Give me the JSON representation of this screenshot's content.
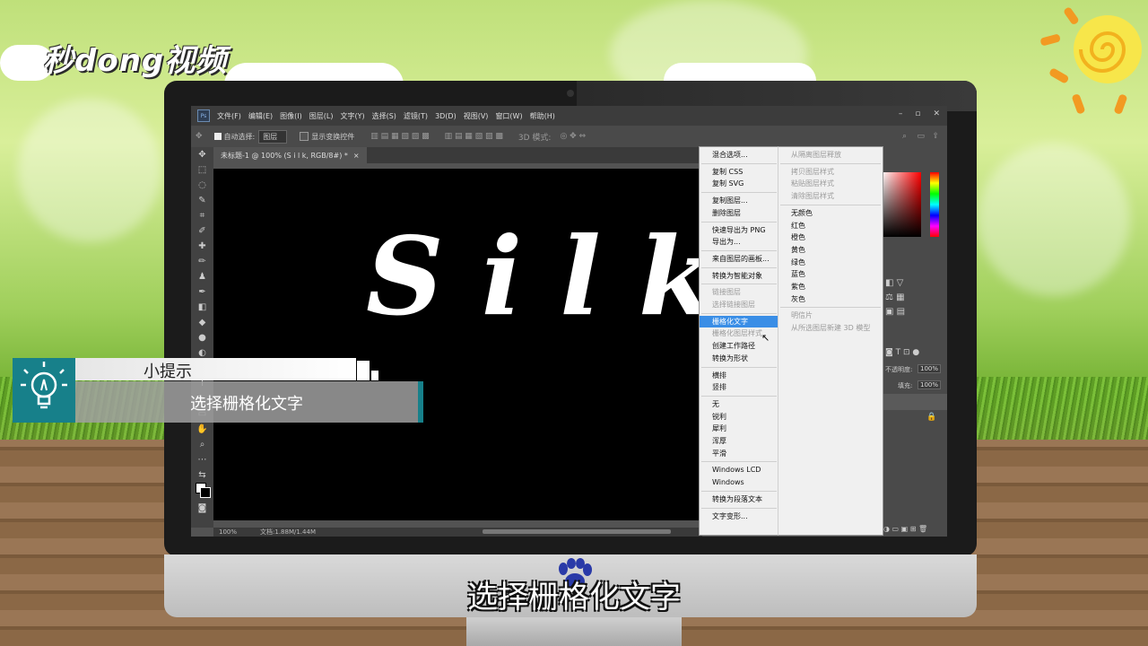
{
  "watermark": {
    "logo_text": "秒dong视频"
  },
  "photoshop": {
    "app_icon": "Ps",
    "menus": [
      "文件(F)",
      "编辑(E)",
      "图像(I)",
      "图层(L)",
      "文字(Y)",
      "选择(S)",
      "滤镜(T)",
      "3D(D)",
      "视图(V)",
      "窗口(W)",
      "帮助(H)"
    ],
    "window_buttons": [
      "–",
      "▫",
      "✕"
    ],
    "options": {
      "auto_select_label": "自动选择:",
      "auto_select_value": "图层",
      "show_transform_label": "显示变换控件",
      "mode_3d_label": "3D 模式:"
    },
    "document_tab": "未标题-1 @ 100% (S i l k, RGB/8#) *",
    "canvas_text": "Silk",
    "status": {
      "zoom": "100%",
      "doc_info": "文档:1.88M/1.44M"
    },
    "panels": {
      "opacity_label": "不透明度:",
      "opacity_value": "100%",
      "fill_label": "填充:",
      "fill_value": "100%"
    },
    "context_menu": [
      {
        "label": "混合选项...",
        "state": "normal"
      },
      {
        "sep": true
      },
      {
        "label": "复制 CSS",
        "state": "normal"
      },
      {
        "label": "复制 SVG",
        "state": "normal"
      },
      {
        "sep": true
      },
      {
        "label": "复制图层...",
        "state": "normal"
      },
      {
        "label": "删除图层",
        "state": "normal"
      },
      {
        "sep": true
      },
      {
        "label": "快速导出为 PNG",
        "state": "normal"
      },
      {
        "label": "导出为...",
        "state": "normal"
      },
      {
        "sep": true
      },
      {
        "label": "来自图层的画板...",
        "state": "normal"
      },
      {
        "sep": true
      },
      {
        "label": "转换为智能对象",
        "state": "normal"
      },
      {
        "sep": true
      },
      {
        "label": "链接图层",
        "state": "disabled"
      },
      {
        "label": "选择链接图层",
        "state": "disabled"
      },
      {
        "sep": true
      },
      {
        "label": "栅格化文字",
        "state": "highlighted"
      },
      {
        "label": "栅格化图层样式",
        "state": "disabled"
      },
      {
        "label": "创建工作路径",
        "state": "normal"
      },
      {
        "label": "转换为形状",
        "state": "normal"
      },
      {
        "sep": true
      },
      {
        "label": "横排",
        "state": "normal"
      },
      {
        "label": "竖排",
        "state": "normal"
      },
      {
        "sep": true
      },
      {
        "label": "无",
        "state": "normal"
      },
      {
        "label": "锐利",
        "state": "normal"
      },
      {
        "label": "犀利",
        "state": "normal"
      },
      {
        "label": "浑厚",
        "state": "normal"
      },
      {
        "label": "平滑",
        "state": "normal"
      },
      {
        "sep": true
      },
      {
        "label": "Windows LCD",
        "state": "normal"
      },
      {
        "label": "Windows",
        "state": "normal"
      },
      {
        "sep": true
      },
      {
        "label": "转换为段落文本",
        "state": "normal"
      },
      {
        "sep": true
      },
      {
        "label": "文字变形...",
        "state": "normal"
      }
    ],
    "sub_menu": [
      {
        "label": "从隔离图层释放",
        "state": "disabled"
      },
      {
        "sep": true
      },
      {
        "label": "拷贝图层样式",
        "state": "disabled"
      },
      {
        "label": "粘贴图层样式",
        "state": "disabled"
      },
      {
        "label": "清除图层样式",
        "state": "disabled"
      },
      {
        "sep": true
      },
      {
        "label": "无颜色",
        "state": "normal"
      },
      {
        "label": "红色",
        "state": "normal"
      },
      {
        "label": "橙色",
        "state": "normal"
      },
      {
        "label": "黄色",
        "state": "normal"
      },
      {
        "label": "绿色",
        "state": "normal"
      },
      {
        "label": "蓝色",
        "state": "normal"
      },
      {
        "label": "紫色",
        "state": "normal"
      },
      {
        "label": "灰色",
        "state": "normal"
      },
      {
        "sep": true
      },
      {
        "label": "明信片",
        "state": "disabled"
      },
      {
        "label": "从所选图层新建 3D 模型",
        "state": "disabled"
      }
    ]
  },
  "tip": {
    "title": "小提示",
    "text": "选择栅格化文字"
  },
  "subtitle": "选择栅格化文字",
  "colors": {
    "teal": "#17808a",
    "menu_highlight": "#3a8ee6"
  }
}
